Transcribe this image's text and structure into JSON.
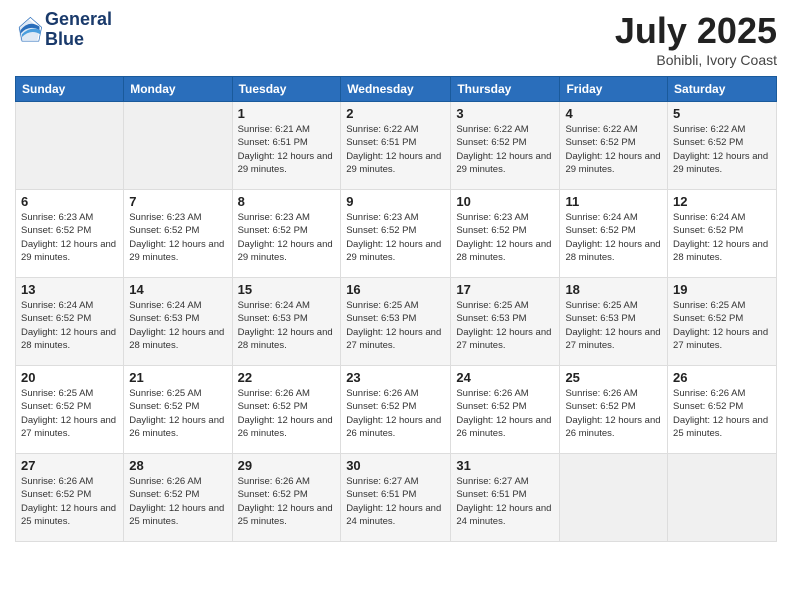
{
  "logo": {
    "line1": "General",
    "line2": "Blue"
  },
  "title": "July 2025",
  "location": "Bohibli, Ivory Coast",
  "headers": [
    "Sunday",
    "Monday",
    "Tuesday",
    "Wednesday",
    "Thursday",
    "Friday",
    "Saturday"
  ],
  "weeks": [
    [
      {
        "day": "",
        "sunrise": "",
        "sunset": "",
        "daylight": ""
      },
      {
        "day": "",
        "sunrise": "",
        "sunset": "",
        "daylight": ""
      },
      {
        "day": "1",
        "sunrise": "Sunrise: 6:21 AM",
        "sunset": "Sunset: 6:51 PM",
        "daylight": "Daylight: 12 hours and 29 minutes."
      },
      {
        "day": "2",
        "sunrise": "Sunrise: 6:22 AM",
        "sunset": "Sunset: 6:51 PM",
        "daylight": "Daylight: 12 hours and 29 minutes."
      },
      {
        "day": "3",
        "sunrise": "Sunrise: 6:22 AM",
        "sunset": "Sunset: 6:52 PM",
        "daylight": "Daylight: 12 hours and 29 minutes."
      },
      {
        "day": "4",
        "sunrise": "Sunrise: 6:22 AM",
        "sunset": "Sunset: 6:52 PM",
        "daylight": "Daylight: 12 hours and 29 minutes."
      },
      {
        "day": "5",
        "sunrise": "Sunrise: 6:22 AM",
        "sunset": "Sunset: 6:52 PM",
        "daylight": "Daylight: 12 hours and 29 minutes."
      }
    ],
    [
      {
        "day": "6",
        "sunrise": "Sunrise: 6:23 AM",
        "sunset": "Sunset: 6:52 PM",
        "daylight": "Daylight: 12 hours and 29 minutes."
      },
      {
        "day": "7",
        "sunrise": "Sunrise: 6:23 AM",
        "sunset": "Sunset: 6:52 PM",
        "daylight": "Daylight: 12 hours and 29 minutes."
      },
      {
        "day": "8",
        "sunrise": "Sunrise: 6:23 AM",
        "sunset": "Sunset: 6:52 PM",
        "daylight": "Daylight: 12 hours and 29 minutes."
      },
      {
        "day": "9",
        "sunrise": "Sunrise: 6:23 AM",
        "sunset": "Sunset: 6:52 PM",
        "daylight": "Daylight: 12 hours and 29 minutes."
      },
      {
        "day": "10",
        "sunrise": "Sunrise: 6:23 AM",
        "sunset": "Sunset: 6:52 PM",
        "daylight": "Daylight: 12 hours and 28 minutes."
      },
      {
        "day": "11",
        "sunrise": "Sunrise: 6:24 AM",
        "sunset": "Sunset: 6:52 PM",
        "daylight": "Daylight: 12 hours and 28 minutes."
      },
      {
        "day": "12",
        "sunrise": "Sunrise: 6:24 AM",
        "sunset": "Sunset: 6:52 PM",
        "daylight": "Daylight: 12 hours and 28 minutes."
      }
    ],
    [
      {
        "day": "13",
        "sunrise": "Sunrise: 6:24 AM",
        "sunset": "Sunset: 6:52 PM",
        "daylight": "Daylight: 12 hours and 28 minutes."
      },
      {
        "day": "14",
        "sunrise": "Sunrise: 6:24 AM",
        "sunset": "Sunset: 6:53 PM",
        "daylight": "Daylight: 12 hours and 28 minutes."
      },
      {
        "day": "15",
        "sunrise": "Sunrise: 6:24 AM",
        "sunset": "Sunset: 6:53 PM",
        "daylight": "Daylight: 12 hours and 28 minutes."
      },
      {
        "day": "16",
        "sunrise": "Sunrise: 6:25 AM",
        "sunset": "Sunset: 6:53 PM",
        "daylight": "Daylight: 12 hours and 27 minutes."
      },
      {
        "day": "17",
        "sunrise": "Sunrise: 6:25 AM",
        "sunset": "Sunset: 6:53 PM",
        "daylight": "Daylight: 12 hours and 27 minutes."
      },
      {
        "day": "18",
        "sunrise": "Sunrise: 6:25 AM",
        "sunset": "Sunset: 6:53 PM",
        "daylight": "Daylight: 12 hours and 27 minutes."
      },
      {
        "day": "19",
        "sunrise": "Sunrise: 6:25 AM",
        "sunset": "Sunset: 6:52 PM",
        "daylight": "Daylight: 12 hours and 27 minutes."
      }
    ],
    [
      {
        "day": "20",
        "sunrise": "Sunrise: 6:25 AM",
        "sunset": "Sunset: 6:52 PM",
        "daylight": "Daylight: 12 hours and 27 minutes."
      },
      {
        "day": "21",
        "sunrise": "Sunrise: 6:25 AM",
        "sunset": "Sunset: 6:52 PM",
        "daylight": "Daylight: 12 hours and 26 minutes."
      },
      {
        "day": "22",
        "sunrise": "Sunrise: 6:26 AM",
        "sunset": "Sunset: 6:52 PM",
        "daylight": "Daylight: 12 hours and 26 minutes."
      },
      {
        "day": "23",
        "sunrise": "Sunrise: 6:26 AM",
        "sunset": "Sunset: 6:52 PM",
        "daylight": "Daylight: 12 hours and 26 minutes."
      },
      {
        "day": "24",
        "sunrise": "Sunrise: 6:26 AM",
        "sunset": "Sunset: 6:52 PM",
        "daylight": "Daylight: 12 hours and 26 minutes."
      },
      {
        "day": "25",
        "sunrise": "Sunrise: 6:26 AM",
        "sunset": "Sunset: 6:52 PM",
        "daylight": "Daylight: 12 hours and 26 minutes."
      },
      {
        "day": "26",
        "sunrise": "Sunrise: 6:26 AM",
        "sunset": "Sunset: 6:52 PM",
        "daylight": "Daylight: 12 hours and 25 minutes."
      }
    ],
    [
      {
        "day": "27",
        "sunrise": "Sunrise: 6:26 AM",
        "sunset": "Sunset: 6:52 PM",
        "daylight": "Daylight: 12 hours and 25 minutes."
      },
      {
        "day": "28",
        "sunrise": "Sunrise: 6:26 AM",
        "sunset": "Sunset: 6:52 PM",
        "daylight": "Daylight: 12 hours and 25 minutes."
      },
      {
        "day": "29",
        "sunrise": "Sunrise: 6:26 AM",
        "sunset": "Sunset: 6:52 PM",
        "daylight": "Daylight: 12 hours and 25 minutes."
      },
      {
        "day": "30",
        "sunrise": "Sunrise: 6:27 AM",
        "sunset": "Sunset: 6:51 PM",
        "daylight": "Daylight: 12 hours and 24 minutes."
      },
      {
        "day": "31",
        "sunrise": "Sunrise: 6:27 AM",
        "sunset": "Sunset: 6:51 PM",
        "daylight": "Daylight: 12 hours and 24 minutes."
      },
      {
        "day": "",
        "sunrise": "",
        "sunset": "",
        "daylight": ""
      },
      {
        "day": "",
        "sunrise": "",
        "sunset": "",
        "daylight": ""
      }
    ]
  ]
}
